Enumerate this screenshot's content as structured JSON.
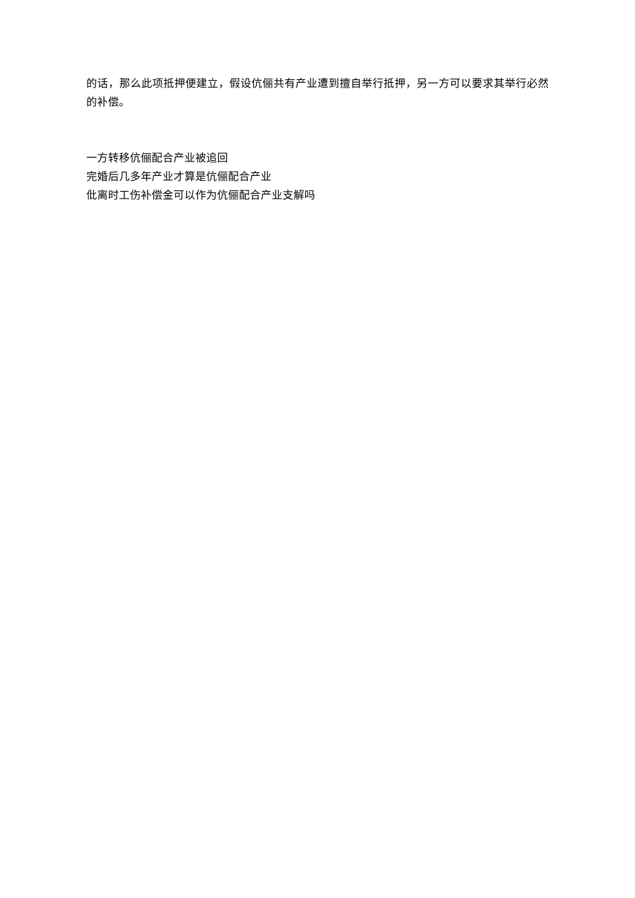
{
  "paragraph": "的话，那么此项抵押便建立，假设伉俪共有产业遭到擅自举行抵押，另一方可以要求其举行必然的补偿。",
  "related": [
    "一方转移伉俪配合产业被追回",
    "完婚后几多年产业才算是伉俪配合产业",
    "仳离时工伤补偿金可以作为伉俪配合产业支解吗"
  ]
}
